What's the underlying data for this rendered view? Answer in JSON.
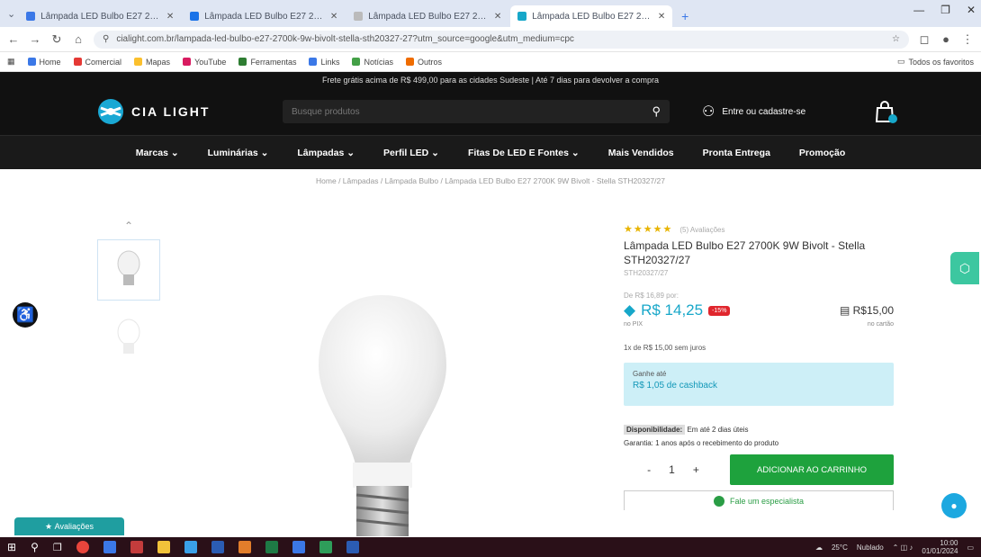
{
  "browser": {
    "tabs": [
      {
        "title": "Lâmpada LED Bulbo E27 2700K",
        "active": false
      },
      {
        "title": "Lâmpada LED Bulbo E27 2700K",
        "active": false
      },
      {
        "title": "Lâmpada LED Bulbo E27 2700K",
        "active": false
      },
      {
        "title": "Lâmpada LED Bulbo E27 2700K",
        "active": true
      }
    ],
    "new_tab": "+",
    "url": "cialight.com.br/lampada-led-bulbo-e27-2700k-9w-bivolt-stella-sth20327-27?utm_source=google&utm_medium=cpc",
    "bookmarks": [
      {
        "label": "Home",
        "color": "#3b78e7"
      },
      {
        "label": "Comercial",
        "color": "#e53935"
      },
      {
        "label": "Mapas",
        "color": "#fbc02d"
      },
      {
        "label": "YouTube",
        "color": "#d81b60"
      },
      {
        "label": "Ferramentas",
        "color": "#2e7d32"
      },
      {
        "label": "Links",
        "color": "#3b78e7"
      },
      {
        "label": "Notícias",
        "color": "#43a047"
      },
      {
        "label": "Outros",
        "color": "#ef6c00"
      }
    ],
    "other_bookmarks": "Todos os favoritos"
  },
  "site": {
    "promo": "Frete grátis acima de R$ 499,00 para as cidades Sudeste | Até 7 dias para devolver a compra",
    "logo": "CIA LIGHT",
    "search_placeholder": "Busque produtos",
    "account": "Entre ou cadastre-se",
    "cart_count": "0",
    "nav": [
      "Marcas",
      "Luminárias",
      "Lâmpadas",
      "Perfil LED",
      "Fitas De LED E Fontes",
      "Mais Vendidos",
      "Pronta Entrega",
      "Promoção"
    ],
    "breadcrumb": "Home / Lâmpadas / Lâmpada Bulbo / Lâmpada LED Bulbo E27 2700K 9W Bivolt - Stella STH20327/27"
  },
  "product": {
    "stars": "★★★★★",
    "reviews": "(5) Avaliações",
    "title": "Lâmpada LED Bulbo E27 2700K 9W Bivolt - Stella STH20327/27",
    "sku": "STH20327/27",
    "old_price": "De R$ 16,89 por:",
    "price": "R$ 14,25",
    "badge": "-15%",
    "price_note": "no PIX",
    "alt_price": "R$15,00",
    "alt_note": "no cartão",
    "installment": "1x de R$ 15,00 sem juros",
    "cashback_l1": "Ganhe até",
    "cashback_l2": "R$ 1,05 de cashback",
    "availability_label": "Disponibilidade:",
    "availability_value": "Em até 2 dias úteis",
    "warranty": "Garantia: 1 anos após o recebimento do produto",
    "qty_minus": "-",
    "qty": "1",
    "qty_plus": "+",
    "add_to_cart": "ADICIONAR AO CARRINHO",
    "whatsapp": "Fale um especialista"
  },
  "widgets": {
    "reviews_tab": "Avaliações",
    "accessibility": "♿"
  },
  "taskbar": {
    "weather": "25°C",
    "weather_desc": "Nublado",
    "time": "10:00",
    "date": "01/01/2024"
  }
}
